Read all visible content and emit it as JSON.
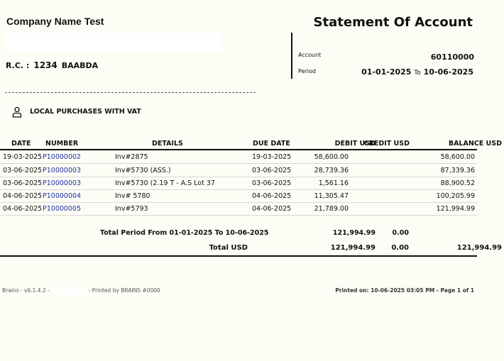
{
  "company": {
    "name": "Company Name Test"
  },
  "rc": {
    "label": "R.C. :",
    "number": "1234",
    "city": "BAABDA"
  },
  "document": {
    "title": "Statement Of Account"
  },
  "account": {
    "label": "Account",
    "value": "60110000"
  },
  "period": {
    "label": "Period",
    "from": "01-01-2025",
    "to_word": "To",
    "to": "10-06-2025"
  },
  "section": {
    "icon": "person-icon",
    "title": "LOCAL PURCHASES WITH VAT"
  },
  "table": {
    "headers": {
      "date": "DATE",
      "number": "NUMBER",
      "details": "DETAILS",
      "due_date": "DUE DATE",
      "debit": "DEBIT USD",
      "credit": "CREDIT USD",
      "balance": "BALANCE USD"
    },
    "rows": [
      {
        "date": "19-03-2025",
        "number": "P10000002",
        "details": "Inv#2875",
        "due_date": "19-03-2025",
        "debit": "58,600.00",
        "balance": "58,600.00"
      },
      {
        "date": "03-06-2025",
        "number": "P10000003",
        "details": "Inv#5730 (ASS.)",
        "due_date": "03-06-2025",
        "debit": "28,739.36",
        "balance": "87,339.36"
      },
      {
        "date": "03-06-2025",
        "number": "P10000003",
        "details": "Inv#5730 (2.19 T - A.S Lot 37",
        "due_date": "03-06-2025",
        "debit": "1,561.16",
        "balance": "88,900.52"
      },
      {
        "date": "04-06-2025",
        "number": "P10000004",
        "details": "Inv# 5780",
        "due_date": "04-06-2025",
        "debit": "11,305.47",
        "balance": "100,205.99"
      },
      {
        "date": "04-06-2025",
        "number": "P10000005",
        "details": "Inv#5793",
        "due_date": "04-06-2025",
        "debit": "21,789.00",
        "balance": "121,994.99"
      }
    ]
  },
  "totals": {
    "period_label": "Total Period From 01-01-2025  To 10-06-2025",
    "period_debit": "121,994.99",
    "period_credit": "0.00",
    "usd_label": "Total USD",
    "usd_debit": "121,994.99",
    "usd_credit": "0.00",
    "usd_balance": "121,994.99"
  },
  "footer": {
    "version": "Brains - v6.1.4.2 -",
    "printed_by": "- Printed by BRAINS #0000",
    "printed_on": "Printed on: 10-06-2025 03:05 PM - Page 1 of 1"
  }
}
